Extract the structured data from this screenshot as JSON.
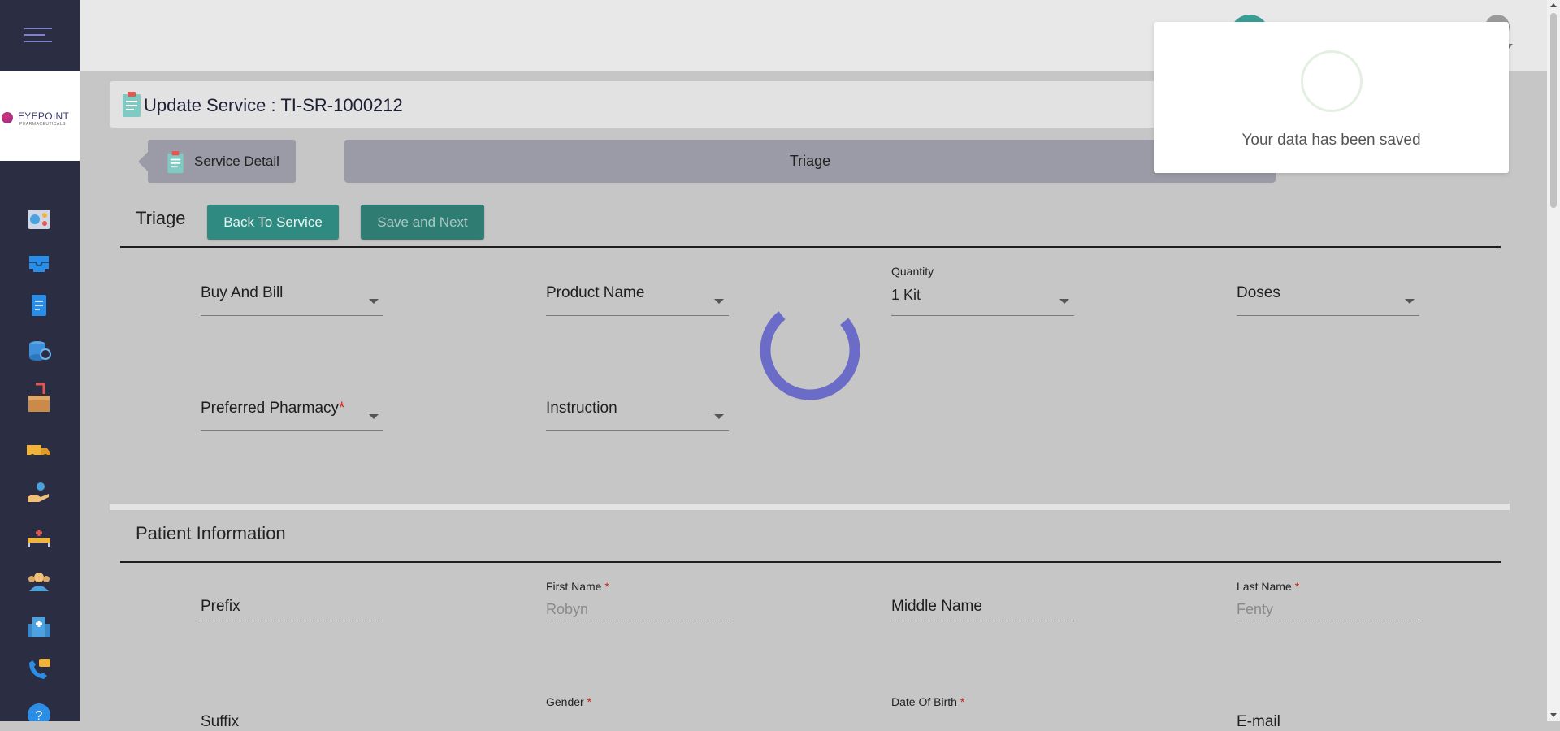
{
  "brand": {
    "logo_text": "EYEPOINT",
    "logo_sub": "PHARMACEUTICALS"
  },
  "header": {
    "page_title": "Update Service : TI-SR-1000212"
  },
  "breadcrumb": {
    "service_detail": "Service Detail",
    "active_tab": "Triage"
  },
  "triage": {
    "title": "Triage",
    "back_button": "Back To Service",
    "save_next_button": "Save and Next",
    "fields": {
      "buy_and_bill": {
        "label": "Buy And Bill"
      },
      "product_name": {
        "label": "Product Name"
      },
      "quantity": {
        "label": "Quantity",
        "value": "1 Kit"
      },
      "doses": {
        "label": "Doses"
      },
      "preferred_pharmacy": {
        "label": "Preferred Pharmacy",
        "required": "*"
      },
      "instruction": {
        "label": "Instruction"
      }
    }
  },
  "patient": {
    "title": "Patient Information",
    "fields": {
      "prefix": {
        "label": "Prefix"
      },
      "first_name": {
        "label": "First Name",
        "required": "*",
        "value": "Robyn"
      },
      "middle_name": {
        "label": "Middle Name"
      },
      "last_name": {
        "label": "Last Name",
        "required": "*",
        "value": "Fenty"
      },
      "suffix": {
        "label": "Suffix"
      },
      "gender": {
        "label": "Gender",
        "required": "*"
      },
      "date_of_birth": {
        "label": "Date Of Birth",
        "required": "*"
      },
      "email": {
        "label": "E-mail"
      }
    }
  },
  "toast": {
    "message": "Your data has been saved"
  },
  "sidebar_icons": [
    "dashboard-icon",
    "inbox-tray-icon",
    "document-icon",
    "database-settings-icon",
    "package-box-icon",
    "delivery-truck-icon",
    "hand-care-icon",
    "hospital-bed-icon",
    "users-group-icon",
    "hospital-building-icon",
    "phone-chat-icon",
    "help-icon"
  ],
  "colors": {
    "sidebar": "#2b2d42",
    "accent_teal": "#2f8b82",
    "spinner": "#6b6bc8",
    "required": "#d0201c"
  }
}
